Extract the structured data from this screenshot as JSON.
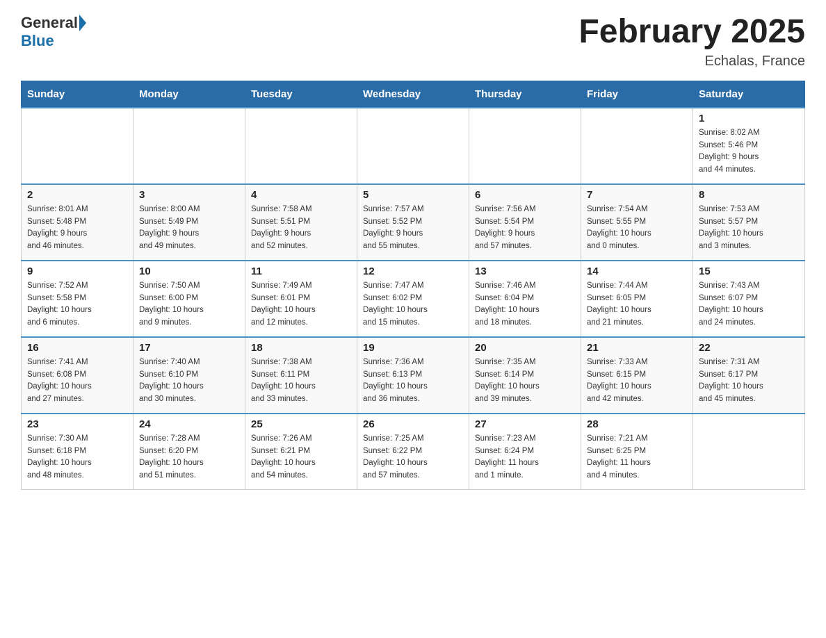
{
  "header": {
    "logo_general": "General",
    "logo_blue": "Blue",
    "title": "February 2025",
    "subtitle": "Echalas, France"
  },
  "days_of_week": [
    "Sunday",
    "Monday",
    "Tuesday",
    "Wednesday",
    "Thursday",
    "Friday",
    "Saturday"
  ],
  "weeks": [
    [
      {
        "day": "",
        "info": ""
      },
      {
        "day": "",
        "info": ""
      },
      {
        "day": "",
        "info": ""
      },
      {
        "day": "",
        "info": ""
      },
      {
        "day": "",
        "info": ""
      },
      {
        "day": "",
        "info": ""
      },
      {
        "day": "1",
        "info": "Sunrise: 8:02 AM\nSunset: 5:46 PM\nDaylight: 9 hours\nand 44 minutes."
      }
    ],
    [
      {
        "day": "2",
        "info": "Sunrise: 8:01 AM\nSunset: 5:48 PM\nDaylight: 9 hours\nand 46 minutes."
      },
      {
        "day": "3",
        "info": "Sunrise: 8:00 AM\nSunset: 5:49 PM\nDaylight: 9 hours\nand 49 minutes."
      },
      {
        "day": "4",
        "info": "Sunrise: 7:58 AM\nSunset: 5:51 PM\nDaylight: 9 hours\nand 52 minutes."
      },
      {
        "day": "5",
        "info": "Sunrise: 7:57 AM\nSunset: 5:52 PM\nDaylight: 9 hours\nand 55 minutes."
      },
      {
        "day": "6",
        "info": "Sunrise: 7:56 AM\nSunset: 5:54 PM\nDaylight: 9 hours\nand 57 minutes."
      },
      {
        "day": "7",
        "info": "Sunrise: 7:54 AM\nSunset: 5:55 PM\nDaylight: 10 hours\nand 0 minutes."
      },
      {
        "day": "8",
        "info": "Sunrise: 7:53 AM\nSunset: 5:57 PM\nDaylight: 10 hours\nand 3 minutes."
      }
    ],
    [
      {
        "day": "9",
        "info": "Sunrise: 7:52 AM\nSunset: 5:58 PM\nDaylight: 10 hours\nand 6 minutes."
      },
      {
        "day": "10",
        "info": "Sunrise: 7:50 AM\nSunset: 6:00 PM\nDaylight: 10 hours\nand 9 minutes."
      },
      {
        "day": "11",
        "info": "Sunrise: 7:49 AM\nSunset: 6:01 PM\nDaylight: 10 hours\nand 12 minutes."
      },
      {
        "day": "12",
        "info": "Sunrise: 7:47 AM\nSunset: 6:02 PM\nDaylight: 10 hours\nand 15 minutes."
      },
      {
        "day": "13",
        "info": "Sunrise: 7:46 AM\nSunset: 6:04 PM\nDaylight: 10 hours\nand 18 minutes."
      },
      {
        "day": "14",
        "info": "Sunrise: 7:44 AM\nSunset: 6:05 PM\nDaylight: 10 hours\nand 21 minutes."
      },
      {
        "day": "15",
        "info": "Sunrise: 7:43 AM\nSunset: 6:07 PM\nDaylight: 10 hours\nand 24 minutes."
      }
    ],
    [
      {
        "day": "16",
        "info": "Sunrise: 7:41 AM\nSunset: 6:08 PM\nDaylight: 10 hours\nand 27 minutes."
      },
      {
        "day": "17",
        "info": "Sunrise: 7:40 AM\nSunset: 6:10 PM\nDaylight: 10 hours\nand 30 minutes."
      },
      {
        "day": "18",
        "info": "Sunrise: 7:38 AM\nSunset: 6:11 PM\nDaylight: 10 hours\nand 33 minutes."
      },
      {
        "day": "19",
        "info": "Sunrise: 7:36 AM\nSunset: 6:13 PM\nDaylight: 10 hours\nand 36 minutes."
      },
      {
        "day": "20",
        "info": "Sunrise: 7:35 AM\nSunset: 6:14 PM\nDaylight: 10 hours\nand 39 minutes."
      },
      {
        "day": "21",
        "info": "Sunrise: 7:33 AM\nSunset: 6:15 PM\nDaylight: 10 hours\nand 42 minutes."
      },
      {
        "day": "22",
        "info": "Sunrise: 7:31 AM\nSunset: 6:17 PM\nDaylight: 10 hours\nand 45 minutes."
      }
    ],
    [
      {
        "day": "23",
        "info": "Sunrise: 7:30 AM\nSunset: 6:18 PM\nDaylight: 10 hours\nand 48 minutes."
      },
      {
        "day": "24",
        "info": "Sunrise: 7:28 AM\nSunset: 6:20 PM\nDaylight: 10 hours\nand 51 minutes."
      },
      {
        "day": "25",
        "info": "Sunrise: 7:26 AM\nSunset: 6:21 PM\nDaylight: 10 hours\nand 54 minutes."
      },
      {
        "day": "26",
        "info": "Sunrise: 7:25 AM\nSunset: 6:22 PM\nDaylight: 10 hours\nand 57 minutes."
      },
      {
        "day": "27",
        "info": "Sunrise: 7:23 AM\nSunset: 6:24 PM\nDaylight: 11 hours\nand 1 minute."
      },
      {
        "day": "28",
        "info": "Sunrise: 7:21 AM\nSunset: 6:25 PM\nDaylight: 11 hours\nand 4 minutes."
      },
      {
        "day": "",
        "info": ""
      }
    ]
  ]
}
